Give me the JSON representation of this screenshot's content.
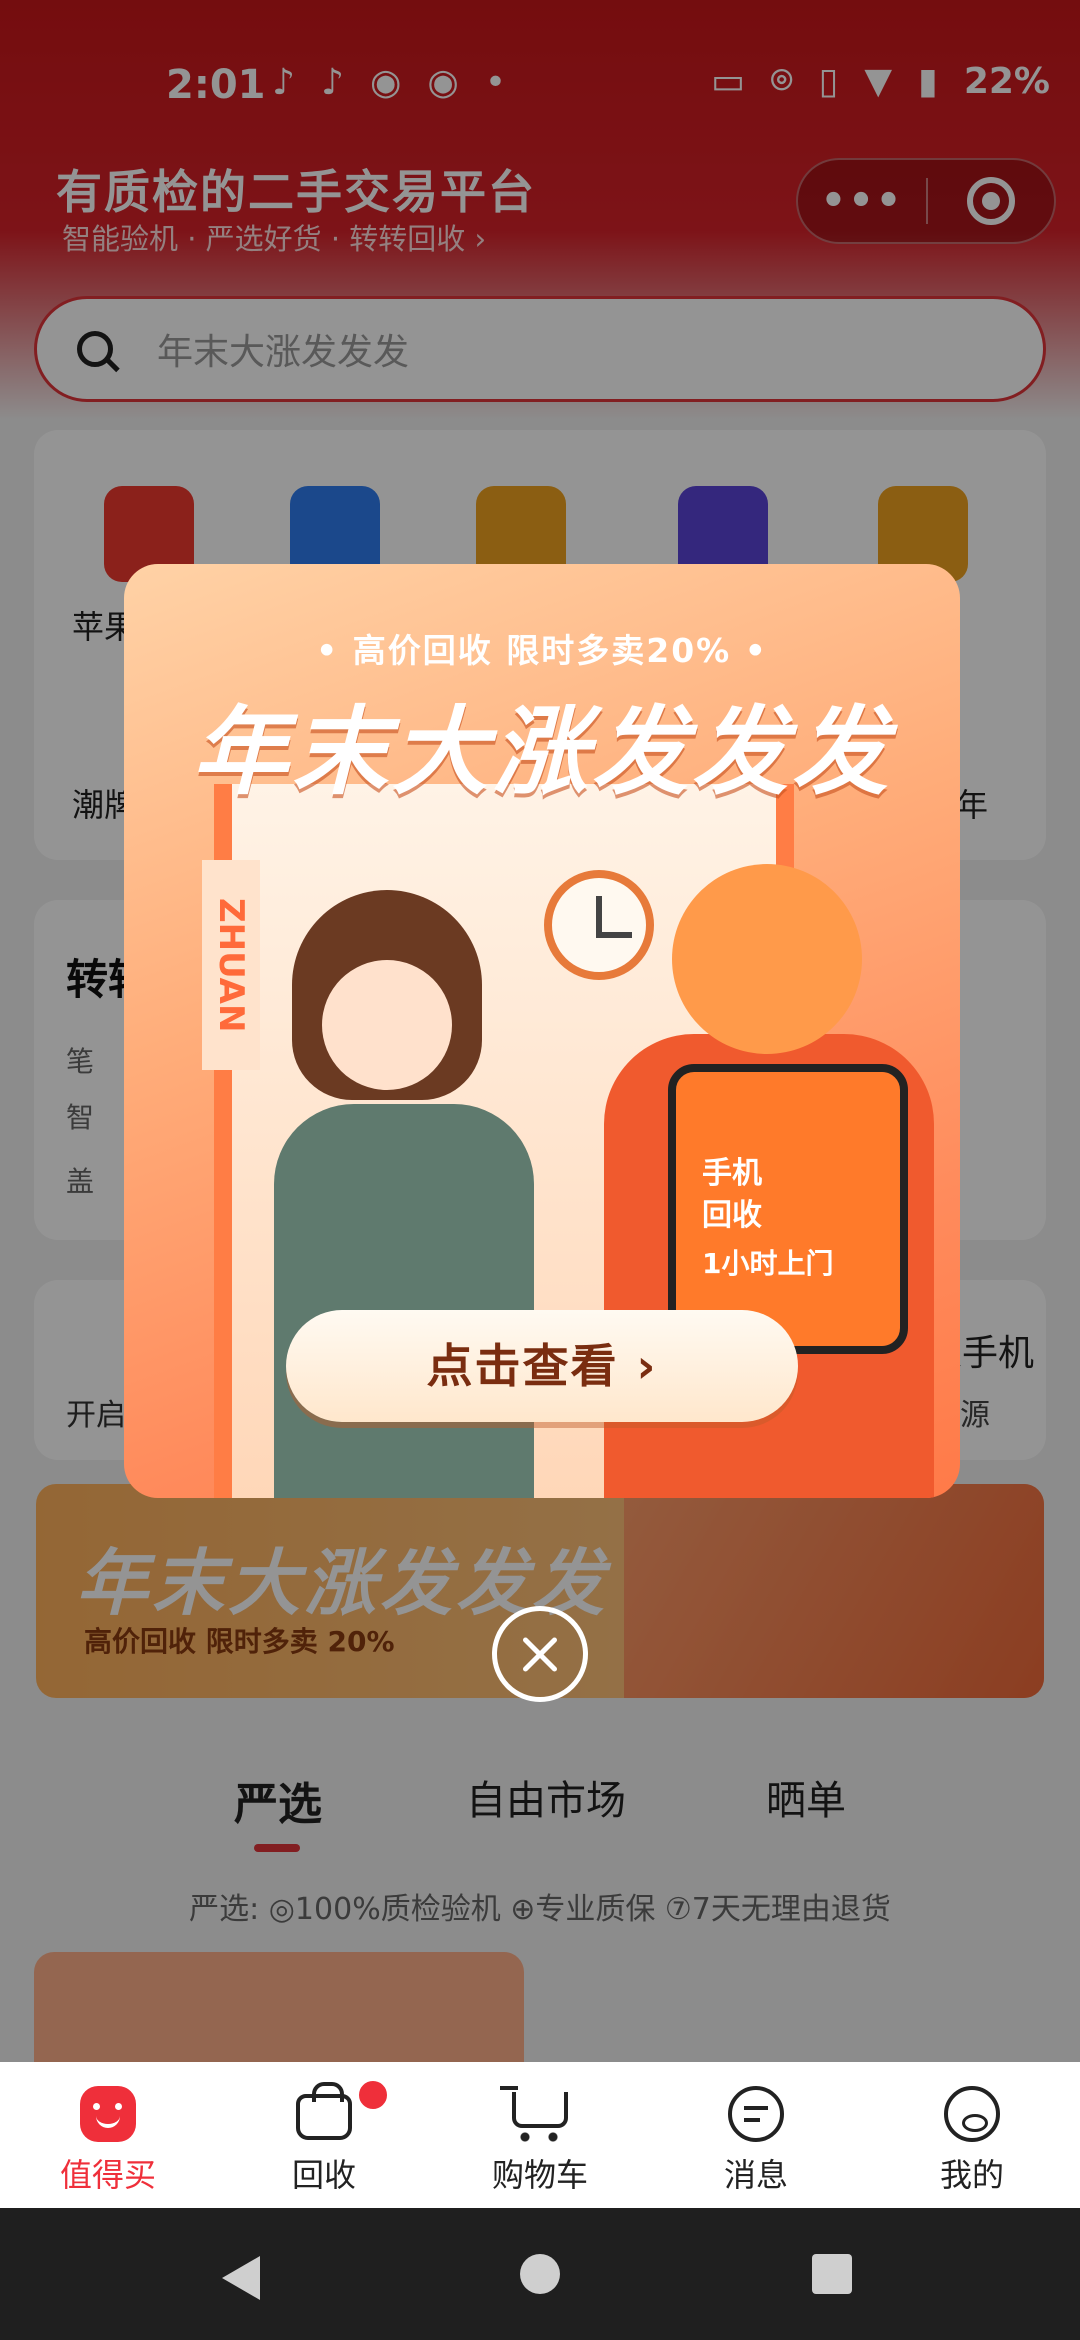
{
  "status_bar": {
    "time": "2:01",
    "battery": "22%",
    "left_icons": [
      "tiktok-icon",
      "tiktok-icon",
      "weibo-icon",
      "weibo-icon",
      "dot-icon"
    ],
    "right_icons": [
      "cast-icon",
      "location-icon",
      "vibrate-icon",
      "wifi-icon",
      "battery-icon"
    ]
  },
  "header": {
    "title": "有质检的二手交易平台",
    "subtitle": "智能验机 · 严选好货 · 转转回收 ›",
    "capsule_more": "•••"
  },
  "search": {
    "placeholder": "年末大涨发发发"
  },
  "categories": {
    "row1_first_label": "苹果",
    "row2_first_label": "潮牌",
    "row2_last_label": "年"
  },
  "section_card": {
    "title": "转转",
    "row1": "笔",
    "row2": "智",
    "row3": "盖"
  },
  "section_card2": {
    "left_text": "开启",
    "right_title": "个人手机",
    "right_sub": "货源"
  },
  "bg_banner": {
    "title": "年末大涨发发发",
    "subtitle": "高价回收  限时多卖 20%"
  },
  "feed_tabs": [
    {
      "label": "严选",
      "active": true
    },
    {
      "label": "自由市场",
      "active": false
    },
    {
      "label": "晒单",
      "active": false
    }
  ],
  "promise_line": "严选: ◎100%质检验机 ⊕专业质保 ⑦7天无理由退货",
  "popup": {
    "tagline": "• 高价回收  限时多卖20% •",
    "headline": "年末大涨发发发",
    "door_sign": "ZHUAN",
    "bag_line1": "手机",
    "bag_line2": "回收",
    "bag_line3": "1小时上门",
    "cta": "点击查看 ›"
  },
  "bottom_tabs": [
    {
      "label": "值得买",
      "icon": "smile-bag-icon",
      "active": true
    },
    {
      "label": "回收",
      "icon": "recycle-bag-icon",
      "active": false,
      "badge": true
    },
    {
      "label": "购物车",
      "icon": "cart-icon",
      "active": false
    },
    {
      "label": "消息",
      "icon": "message-icon",
      "active": false
    },
    {
      "label": "我的",
      "icon": "bear-icon",
      "active": false
    }
  ],
  "colors": {
    "brand_red": "#ef2f3a",
    "header_red": "#c9171a",
    "popup_orange": "#ff8b5c"
  }
}
